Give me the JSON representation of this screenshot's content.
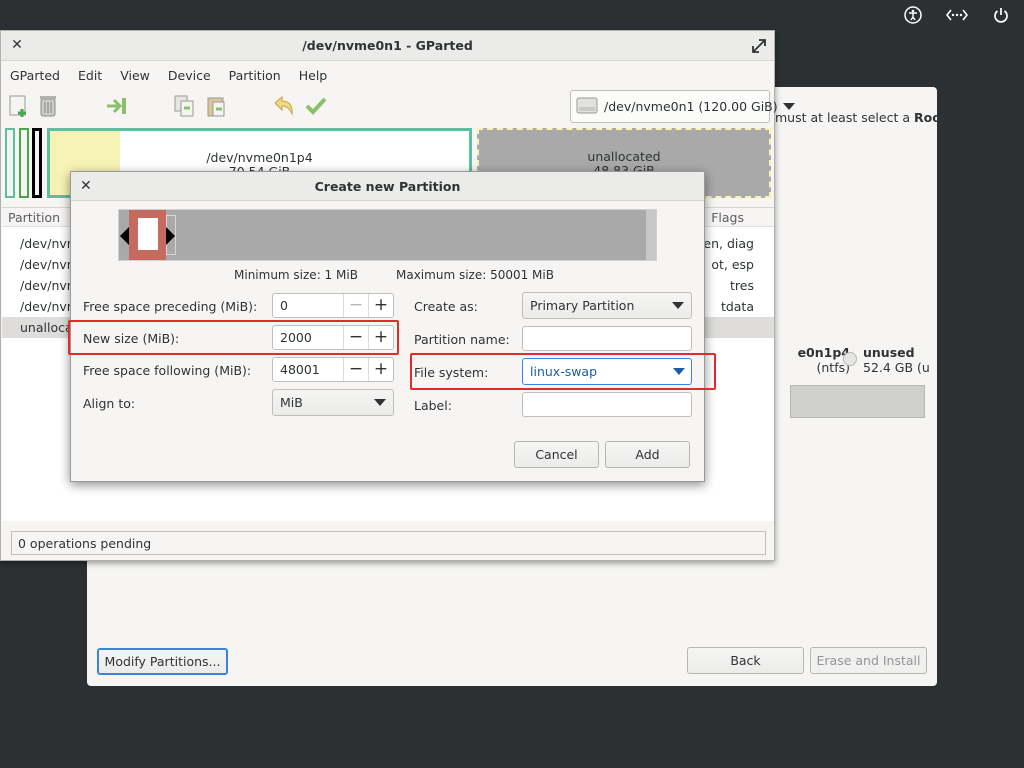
{
  "tray": {
    "icons": [
      "accessibility-icon",
      "network-icon",
      "power-icon"
    ]
  },
  "installer": {
    "hint_text": "must at least select a",
    "hint_bold": "Root",
    "partition_name": "e0n1p4",
    "partition_fs": "(ntfs)",
    "unused_label": "unused",
    "unused_size": "52.4 GB (u",
    "modify_button": "Modify Partitions...",
    "back_button": "Back",
    "erase_button": "Erase and Install"
  },
  "gparted": {
    "title": "/dev/nvme0n1 - GParted",
    "menu": [
      "GParted",
      "Edit",
      "View",
      "Device",
      "Partition",
      "Help"
    ],
    "device_combo": "/dev/nvme0n1  (120.00 GiB)",
    "diskmap": {
      "p4_name": "/dev/nvme0n1p4",
      "p4_size": "70.54 GiB",
      "unalloc_name": "unallocated",
      "unalloc_size": "48.83 GiB"
    },
    "columns": {
      "partition": "Partition",
      "flags": "Flags"
    },
    "rows": [
      {
        "name": "/dev/nvm",
        "flags": "den, diag"
      },
      {
        "name": "/dev/nvm",
        "flags": "ot, esp"
      },
      {
        "name": "/dev/nvm",
        "flags": "tres"
      },
      {
        "name": "/dev/nvm",
        "flags": "tdata"
      },
      {
        "name": "unalloca",
        "flags": ""
      }
    ],
    "status": "0 operations pending"
  },
  "dialog": {
    "title": "Create new Partition",
    "min_size": "Minimum size: 1 MiB",
    "max_size": "Maximum size: 50001 MiB",
    "free_preceding_label": "Free space preceding (MiB):",
    "free_preceding_value": "0",
    "new_size_label": "New size (MiB):",
    "new_size_value": "2000",
    "free_following_label": "Free space following (MiB):",
    "free_following_value": "48001",
    "align_label": "Align to:",
    "align_value": "MiB",
    "create_as_label": "Create as:",
    "create_as_value": "Primary Partition",
    "partition_name_label": "Partition name:",
    "partition_name_value": "",
    "file_system_label": "File system:",
    "file_system_value": "linux-swap",
    "label_label": "Label:",
    "label_value": "",
    "cancel_button": "Cancel",
    "add_button": "Add",
    "minus": "−",
    "plus": "+"
  },
  "colors": {
    "highlight": "#e32b2b",
    "accent": "#3584e4",
    "slider_selection": "#c46a5f",
    "unallocated": "#a9a9a9",
    "ntfs_partition": "#5ebf9e"
  }
}
